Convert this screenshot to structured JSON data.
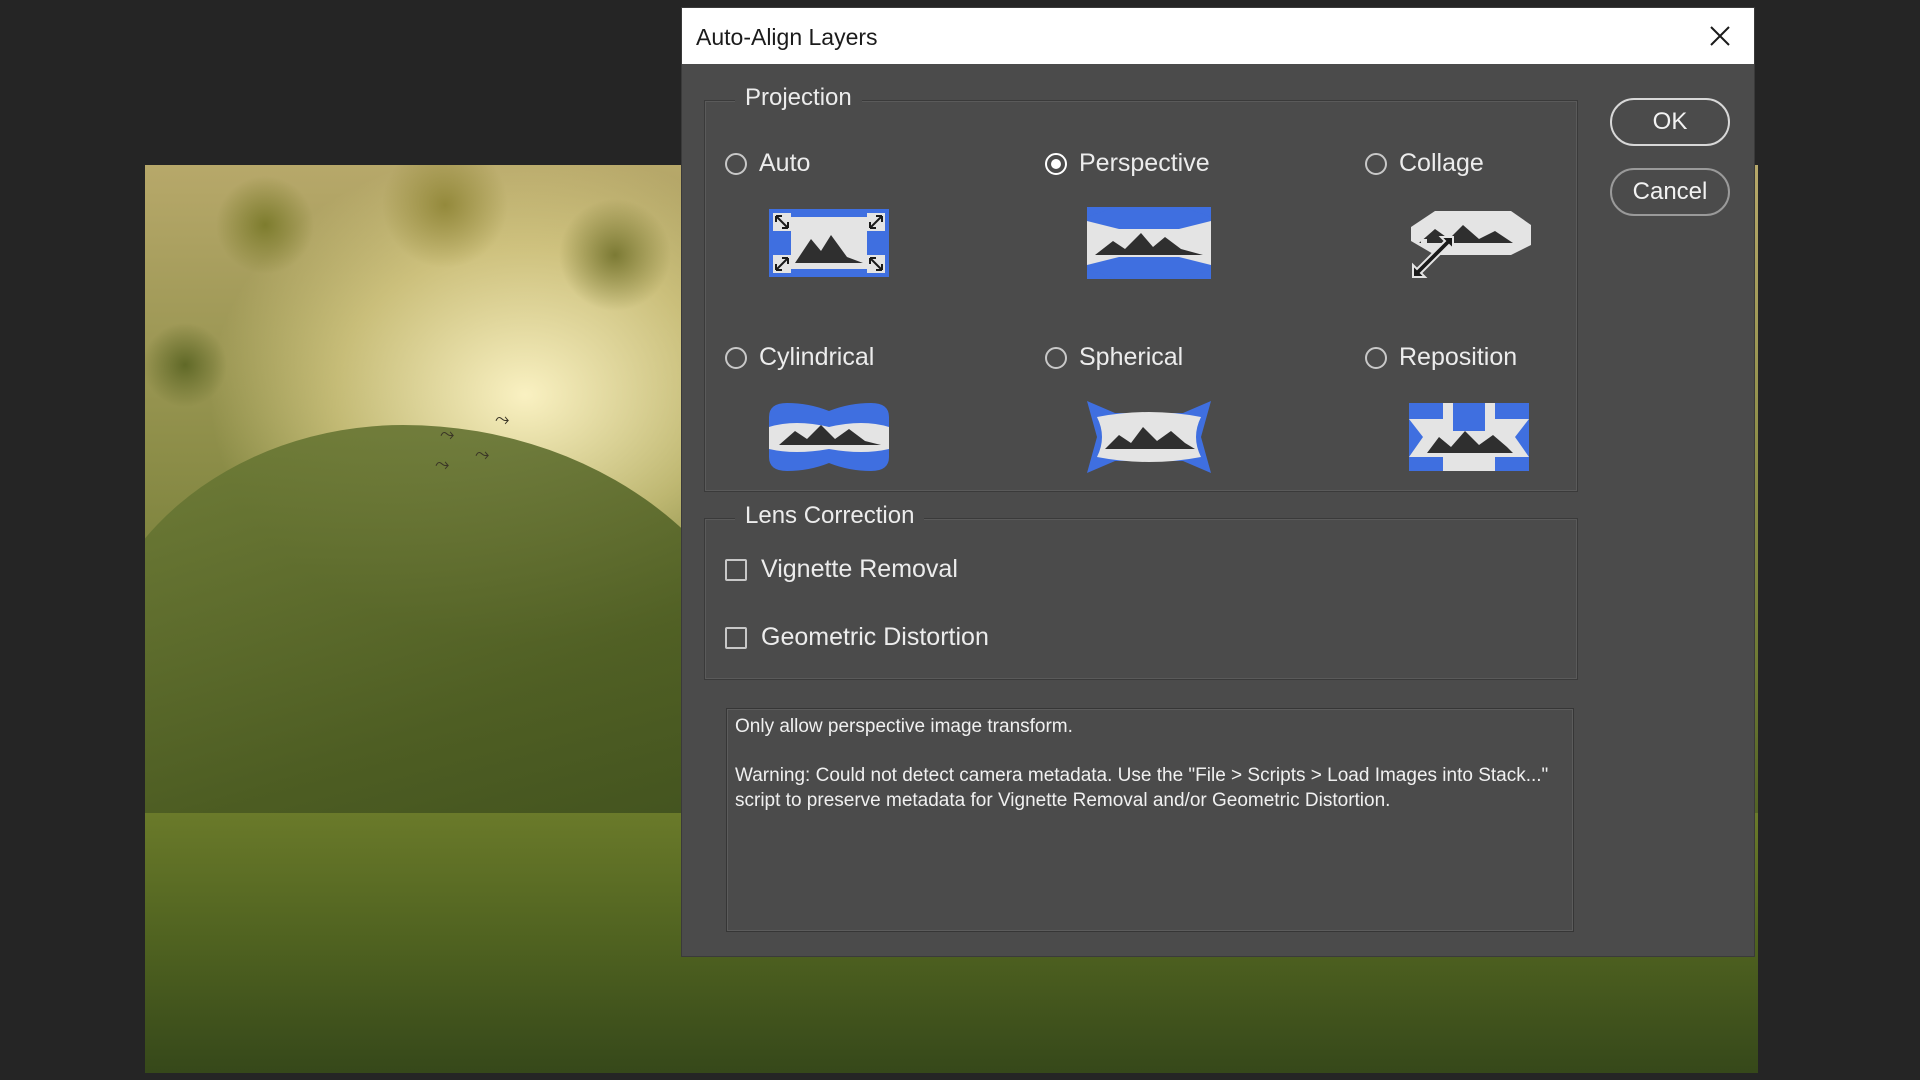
{
  "dialog": {
    "title": "Auto-Align Layers",
    "close_icon": "close-icon",
    "projection": {
      "label": "Projection",
      "selected": "Perspective",
      "options": [
        {
          "label": "Auto",
          "checked": false,
          "icon": "auto-projection-icon"
        },
        {
          "label": "Perspective",
          "checked": true,
          "icon": "perspective-projection-icon"
        },
        {
          "label": "Collage",
          "checked": false,
          "icon": "collage-projection-icon"
        },
        {
          "label": "Cylindrical",
          "checked": false,
          "icon": "cylindrical-projection-icon"
        },
        {
          "label": "Spherical",
          "checked": false,
          "icon": "spherical-projection-icon"
        },
        {
          "label": "Reposition",
          "checked": false,
          "icon": "reposition-projection-icon"
        }
      ]
    },
    "lens_correction": {
      "label": "Lens Correction",
      "options": [
        {
          "label": "Vignette Removal",
          "checked": false
        },
        {
          "label": "Geometric Distortion",
          "checked": false
        }
      ]
    },
    "description": "Only allow perspective image transform.\n\nWarning: Could not detect camera metadata. Use the \"File > Scripts > Load Images into Stack...\" script to preserve metadata for Vignette Removal and/or Geometric Distortion.",
    "buttons": {
      "ok": "OK",
      "cancel": "Cancel"
    }
  },
  "colors": {
    "dialog_bg": "#4b4b4b",
    "titlebar_bg": "#ffffff",
    "app_bg": "#252525",
    "icon_accent": "#3f6fe0",
    "icon_fill": "#e4e4e4"
  }
}
